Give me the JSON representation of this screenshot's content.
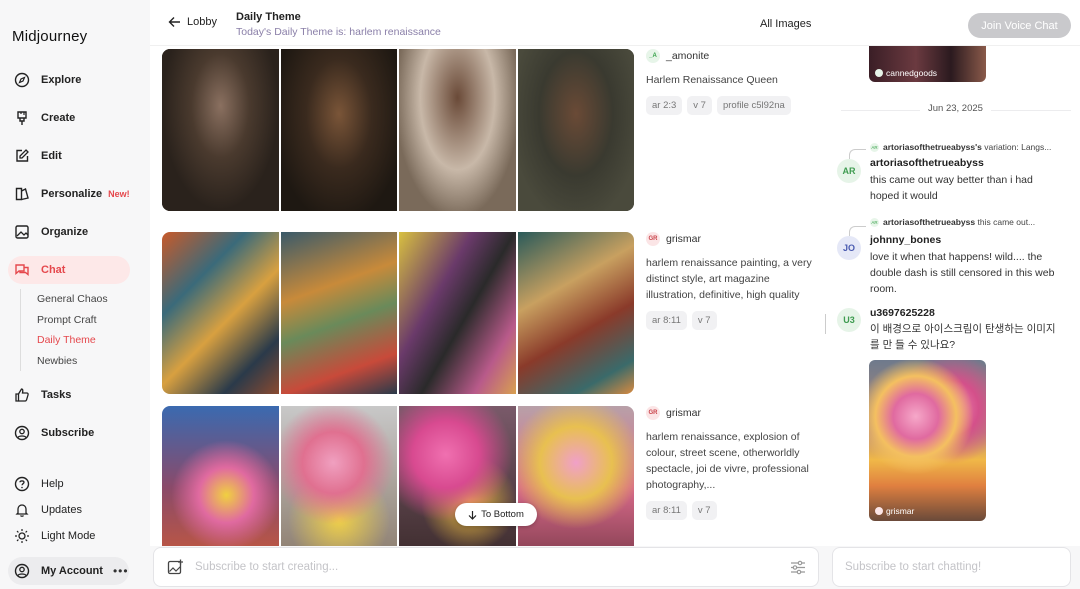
{
  "brand": "Midjourney",
  "sidebar": {
    "items": [
      {
        "label": "Explore",
        "icon": "compass-icon"
      },
      {
        "label": "Create",
        "icon": "brush-icon"
      },
      {
        "label": "Edit",
        "icon": "edit-icon"
      },
      {
        "label": "Personalize",
        "icon": "personalize-icon",
        "badge": "New!"
      },
      {
        "label": "Organize",
        "icon": "image-icon"
      },
      {
        "label": "Chat",
        "icon": "chat-icon"
      },
      {
        "label": "Tasks",
        "icon": "thumbs-up-icon"
      },
      {
        "label": "Subscribe",
        "icon": "subscribe-icon"
      }
    ],
    "chat_rooms": [
      "General Chaos",
      "Prompt Craft",
      "Daily Theme",
      "Newbies"
    ],
    "active_room": "Daily Theme",
    "bottom": [
      {
        "label": "Help",
        "icon": "help-icon"
      },
      {
        "label": "Updates",
        "icon": "bell-icon"
      },
      {
        "label": "Light Mode",
        "icon": "sun-icon"
      }
    ],
    "account": "My Account",
    "account_more": "•••"
  },
  "header": {
    "back_label": "Lobby",
    "title": "Daily Theme",
    "subtitle": "Today's Daily Theme is: harlem renaissance",
    "all_images": "All Images",
    "voice_chat": "Join Voice Chat"
  },
  "feed": {
    "posts": [
      {
        "avatar": "_A",
        "author": "_amonite",
        "prompt": "Harlem Renaissance Queen",
        "tags": [
          "ar 2:3",
          "v 7",
          "profile c5l92na"
        ]
      },
      {
        "avatar": "GR",
        "author": "grismar",
        "prompt": "harlem renaissance painting, a very distinct style, art magazine illustration, definitive, high quality",
        "tags": [
          "ar 8:11",
          "v 7"
        ]
      },
      {
        "avatar": "GR",
        "author": "grismar",
        "prompt": "harlem renaissance, explosion of colour, street scene, otherworldly spectacle, joi de vivre, professional photography,...",
        "tags": [
          "ar 8:11",
          "v 7"
        ]
      }
    ],
    "to_bottom": "To Bottom"
  },
  "create_bar": {
    "placeholder": "Subscribe to start creating..."
  },
  "chat": {
    "top_thumb_user": "cannedgoods",
    "date": "Jun 23, 2025",
    "messages": [
      {
        "reply_avatar": "AR",
        "reply_user": "artoriasofthetrueabyss's",
        "reply_text": "variation: Langs...",
        "avatar": "AR",
        "name": "artoriasofthetrueabyss",
        "text": "this came out way better than i had hoped it would"
      },
      {
        "reply_avatar": "AR",
        "reply_user": "artoriasofthetrueabyss",
        "reply_text": "this came out...",
        "avatar": "JO",
        "name": "johnny_bones",
        "text": "love it when that happens! wild.... the double dash is still censored in this web room."
      },
      {
        "avatar": "U3",
        "name": "u3697625228",
        "text": "이 배경으로 아이스크림이 탄생하는 이미지를 만 들 수 있나요?"
      }
    ],
    "image_user": "grismar",
    "input_placeholder": "Subscribe to start chatting!"
  },
  "colors": {
    "accent": "#e5484d",
    "active_bg": "#fde8e8",
    "subtitle": "#8a7fa8"
  }
}
